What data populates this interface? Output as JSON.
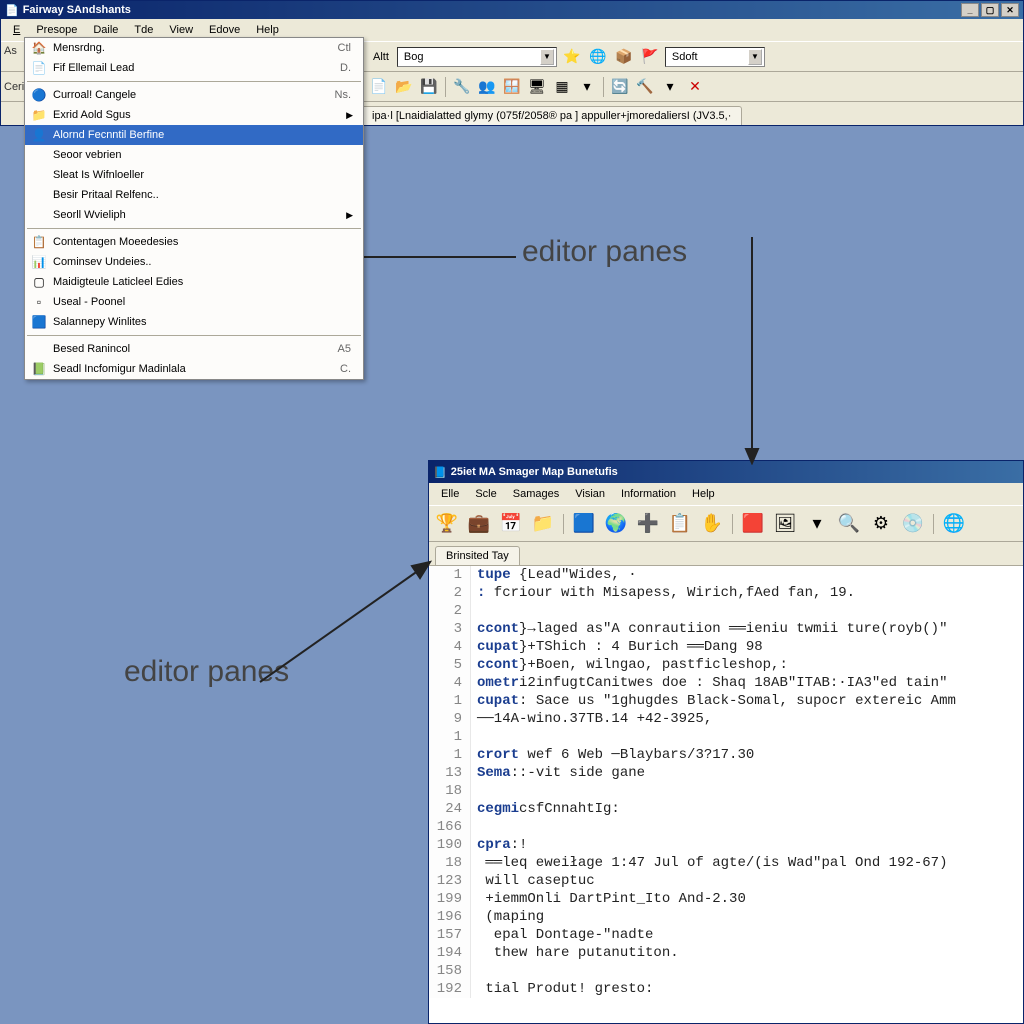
{
  "win1": {
    "title": "Fairway SAndshants",
    "menu": [
      "E",
      "Presope",
      "Daile",
      "Tde",
      "View",
      "Edove",
      "Help"
    ],
    "menu_side": [
      "As",
      "Ceri"
    ],
    "toolbar": {
      "lbl1": "Altt",
      "combo1": "Bog",
      "combo2": "Sdoft"
    },
    "tab": "ipa·l [Lnaidialatted glymy (075f/2058® pa ] appuller+jmoredaliersI (JV3.5,·"
  },
  "dropdown": {
    "items": [
      {
        "icon": "🏠",
        "text": "Mensrdng.",
        "shortcut": "Ctl"
      },
      {
        "icon": "📄",
        "text": "Fif Ellemail Lead",
        "shortcut": "D."
      },
      {
        "sep": true
      },
      {
        "icon": "🔵",
        "text": "Curroal! Cangele",
        "shortcut": "Ns."
      },
      {
        "icon": "📁",
        "text": "Exrid Aold Sgus",
        "arrow": true
      },
      {
        "icon": "👤",
        "text": "Alornd Fecnntil Berfine",
        "sel": true
      },
      {
        "icon": "",
        "text": "Seoor vebrien"
      },
      {
        "icon": "",
        "text": "Sleat Is Wifnloeller"
      },
      {
        "icon": "",
        "text": "Besir Pritaal Relfenc.."
      },
      {
        "icon": "",
        "text": "Seorll Wvieliph",
        "arrow": true
      },
      {
        "sep": true
      },
      {
        "icon": "📋",
        "text": "Contentagen Moeedesies"
      },
      {
        "icon": "📊",
        "text": "Cominsev Undeies.."
      },
      {
        "icon": "▢",
        "text": "Maidigteule Laticleel Edies"
      },
      {
        "icon": "▫",
        "text": "Useal - Poonel"
      },
      {
        "icon": "🟦",
        "text": "Salannepy Winlites"
      },
      {
        "sep": true
      },
      {
        "icon": "",
        "text": "Besed Ranincol",
        "shortcut": "A5"
      },
      {
        "icon": "📗",
        "text": "Seadl Incfomigur Madinlala",
        "shortcut": "C."
      }
    ]
  },
  "win2": {
    "title": "25iet MA Smager Map Bunetufis",
    "menu": [
      "Elle",
      "Scle",
      "Samages",
      "Visian",
      "Information",
      "Help"
    ],
    "tab": "Brinsited Tay",
    "lines": [
      {
        "n": "1",
        "kw": "tupe",
        "rest": " {Lead\"Wides, ·"
      },
      {
        "n": "2",
        "kw": ":",
        "rest": " fcriour with Misapess, Wirich,fAed fan, 19."
      },
      {
        "n": "2",
        "kw": "",
        "rest": ""
      },
      {
        "n": "3",
        "kw": "ccont",
        "rest": "}→laged as\"A conrautiion ══ieniu twmii ture(royb()\""
      },
      {
        "n": "4",
        "kw": "cupat",
        "rest": "}+TShich : 4 Burich ══Dang 98"
      },
      {
        "n": "5",
        "kw": "ccont",
        "rest": "}+Boen, wilngao, pastficleshop,:"
      },
      {
        "n": "4",
        "kw": "ometr",
        "rest": "i2infugtCanitwes doe : Shaq 18AB\"ITAB:·IA3\"ed tain\""
      },
      {
        "n": "1",
        "kw": "cupat",
        "rest": ": Sace us \"1ghugdes Black-Somal, supocr extereic Amm"
      },
      {
        "n": "9",
        "kw": "",
        "rest": "──14A-wino.37TB.14 +42-3925,"
      },
      {
        "n": "1",
        "kw": "",
        "rest": ""
      },
      {
        "n": "1",
        "kw": "crort",
        "rest": " wef 6 Web ─Blaybars/3?17.30"
      },
      {
        "n": "13",
        "kw": "Sema",
        "rest": "::-vit side gane"
      },
      {
        "n": "18",
        "kw": "",
        "rest": ""
      },
      {
        "n": "24",
        "kw": "cegmi",
        "rest": "csfCnnahtIg:"
      },
      {
        "n": "166",
        "kw": "",
        "rest": ""
      },
      {
        "n": "190",
        "kw": "cpra",
        "rest": ":!"
      },
      {
        "n": "18",
        "kw": "",
        "rest": " ══leq eweiłage 1:47 Jul of agte/(is Wad\"pal Ond 192-67)"
      },
      {
        "n": "123",
        "kw": "",
        "rest": " will caseptuc"
      },
      {
        "n": "199",
        "kw": "",
        "rest": " +iemmOnli DartPint_Ito And-2.30"
      },
      {
        "n": "196",
        "kw": "",
        "rest": " (maping"
      },
      {
        "n": "157",
        "kw": "",
        "rest": "  epal Dontage-\"nadte"
      },
      {
        "n": "194",
        "kw": "",
        "rest": "  thew hare putanutiton."
      },
      {
        "n": "158",
        "kw": "",
        "rest": ""
      },
      {
        "n": "192",
        "kw": "",
        "rest": " tial Produt! gresto:"
      }
    ]
  },
  "annotations": {
    "label1": "editor panes",
    "label2": "editor panes"
  }
}
